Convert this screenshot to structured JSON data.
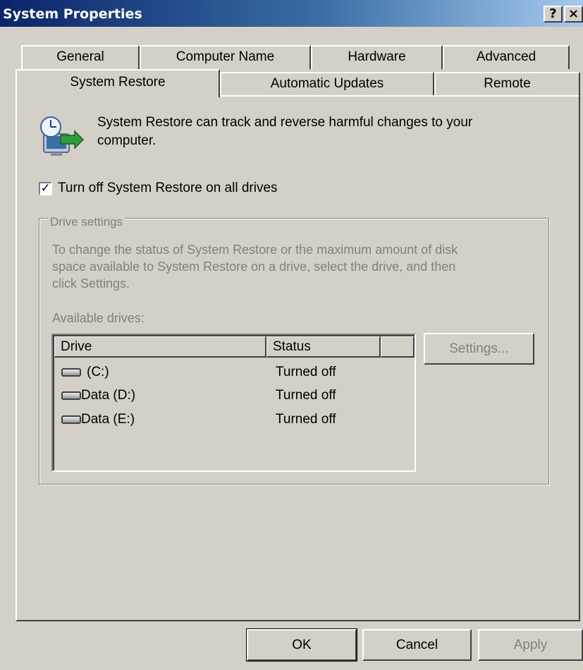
{
  "window": {
    "title": "System Properties",
    "help_label": "?",
    "close_label": "×"
  },
  "tabs": {
    "row_back": [
      "General",
      "Computer Name",
      "Hardware",
      "Advanced"
    ],
    "row_front": [
      "System Restore",
      "Automatic Updates",
      "Remote"
    ],
    "active": "System Restore"
  },
  "system_restore": {
    "description": "System Restore can track and reverse harmful changes to your computer.",
    "description_line1": "System Restore can track and reverse harmful changes to your",
    "description_line2": "computer.",
    "turn_off_label": "Turn off System Restore on all drives",
    "turn_off_checked": true,
    "checkmark": "✓",
    "drive_settings": {
      "legend": "Drive settings",
      "instructions_line1": "To change the status of System Restore or the maximum amount of disk",
      "instructions_line2": "space available to System Restore on a drive, select the drive, and then",
      "instructions_line3": "click Settings.",
      "available_drives_label": "Available drives:",
      "columns": [
        "Drive",
        "Status",
        ""
      ],
      "drives": [
        {
          "drive": "(C:)",
          "status": "Turned off"
        },
        {
          "drive": "Data (D:)",
          "status": "Turned off"
        },
        {
          "drive": "Data (E:)",
          "status": "Turned off"
        }
      ],
      "settings_button": "Settings..."
    }
  },
  "footer": {
    "ok": "OK",
    "cancel": "Cancel",
    "apply": "Apply"
  },
  "icons": {
    "system_restore": "system-restore-icon",
    "drive": "hard-drive-icon"
  }
}
